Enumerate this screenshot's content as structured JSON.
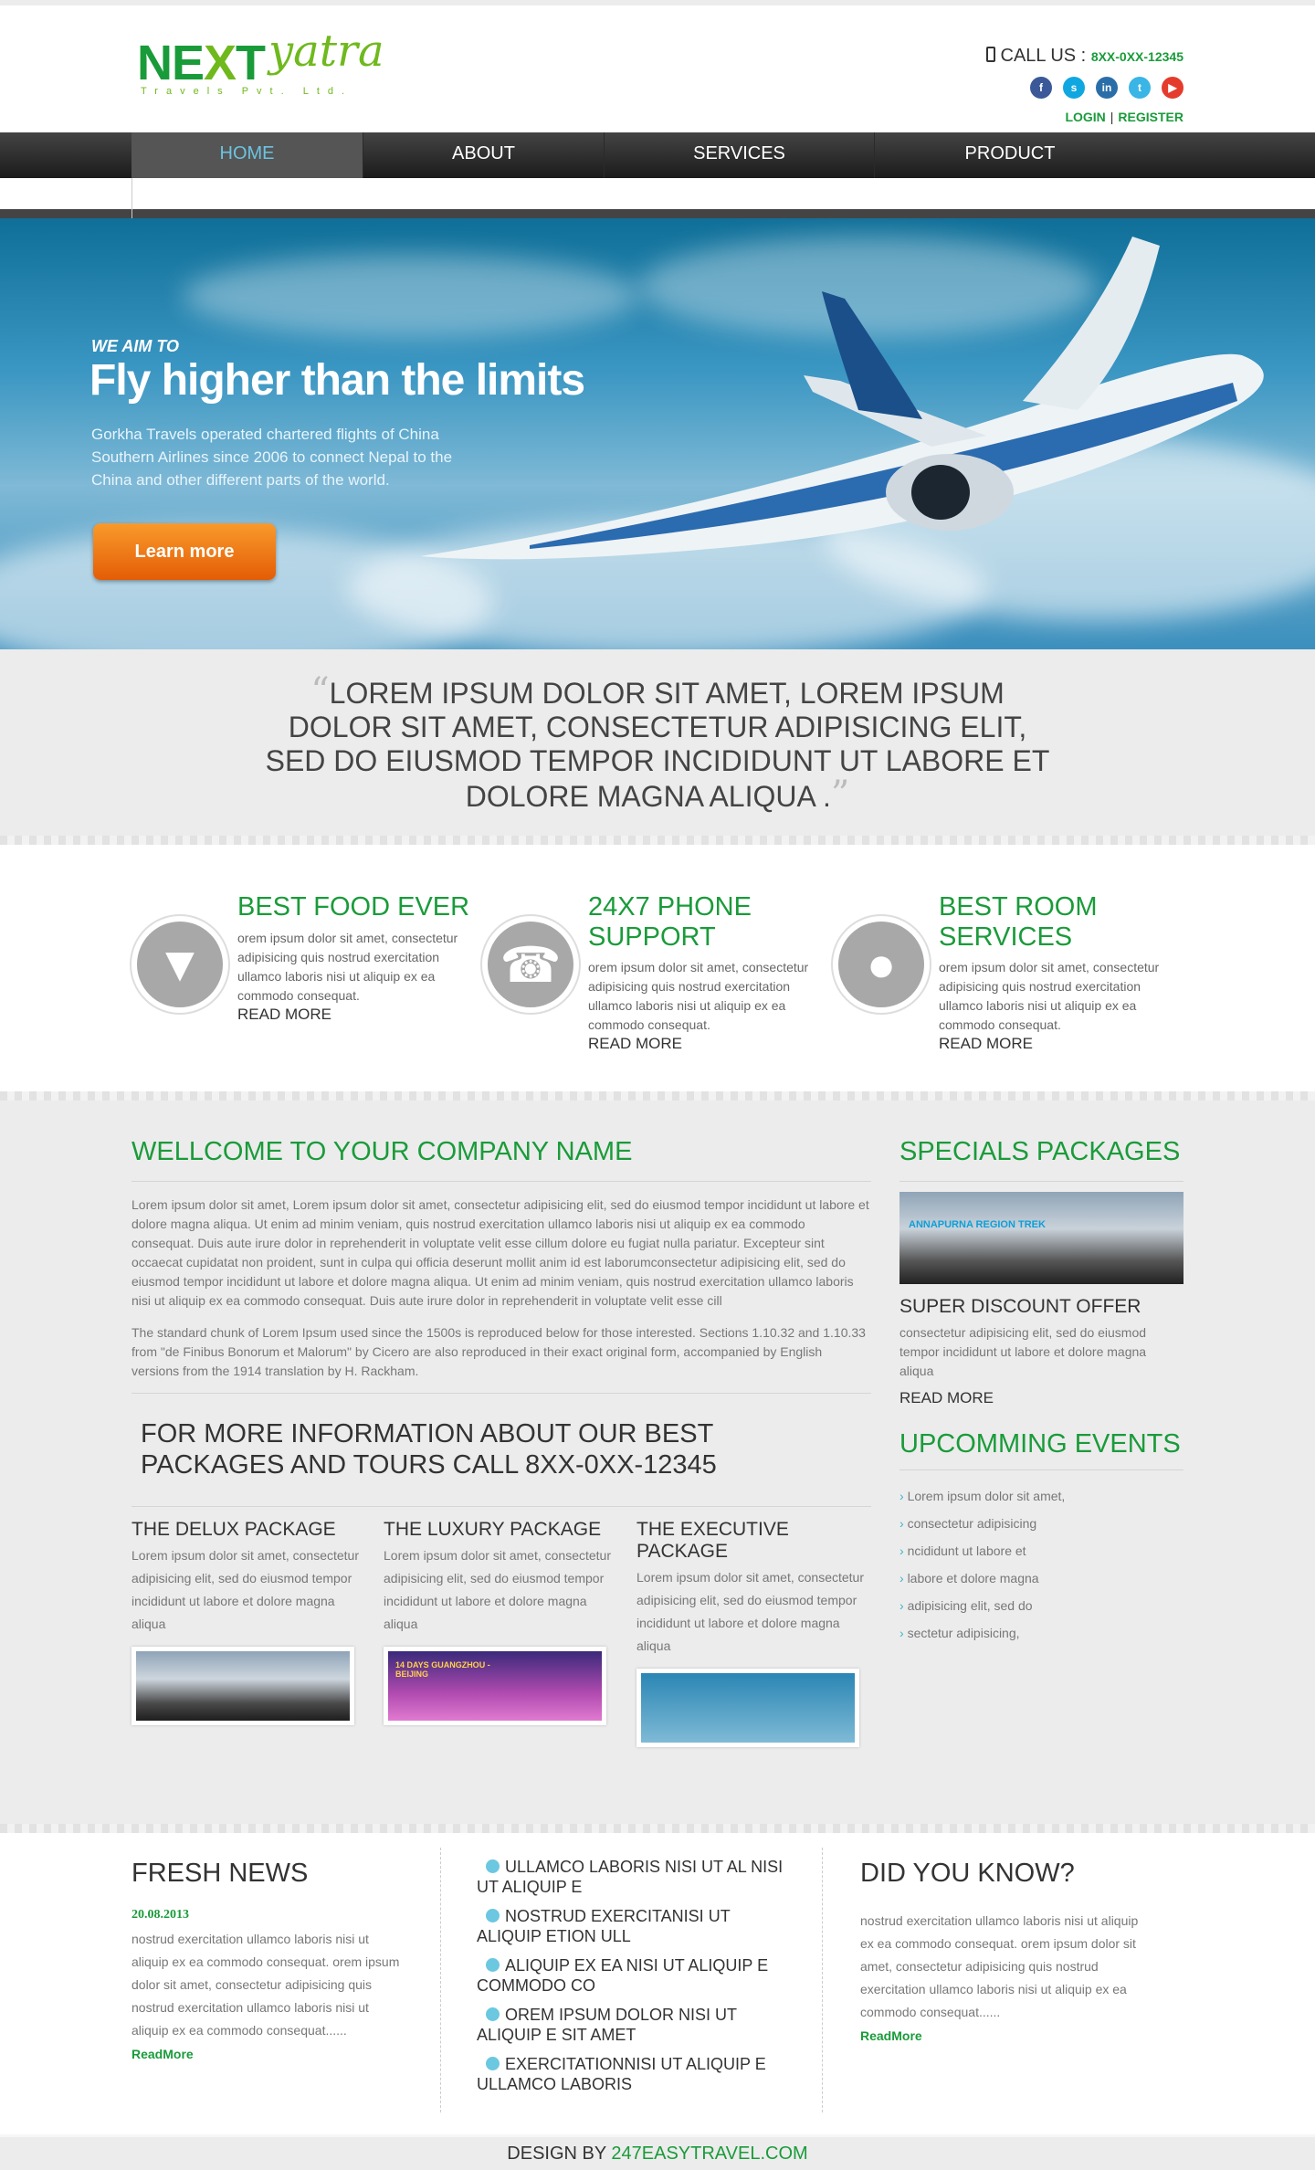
{
  "header": {
    "logo_next": "NEXT",
    "logo_yatra": "yatra",
    "logo_sub": "Travels Pvt. Ltd.",
    "call_label": "CALL US :",
    "call_number": "8XX-0XX-12345",
    "socials": [
      {
        "icon": "facebook-icon",
        "glyph": "f",
        "color": "#3b5998"
      },
      {
        "icon": "skype-icon",
        "glyph": "s",
        "color": "#10a7e0"
      },
      {
        "icon": "linkedin-icon",
        "glyph": "in",
        "color": "#2a6ea9"
      },
      {
        "icon": "twitter-icon",
        "glyph": "t",
        "color": "#39b5e6"
      },
      {
        "icon": "youtube-icon",
        "glyph": "▶",
        "color": "#e53b2c"
      }
    ],
    "login": "LOGIN",
    "register": "REGISTER"
  },
  "nav": {
    "items": [
      "HOME",
      "ABOUT",
      "SERVICES",
      "PRODUCT"
    ],
    "active": "HOME"
  },
  "hero": {
    "aim": "WE AIM TO",
    "title": "Fly higher than the limits",
    "text": "Gorkha Travels operated chartered flights of China Southern Airlines since 2006 to connect Nepal to the China and other different parts of the world.",
    "button": "Learn more"
  },
  "quote": {
    "text": "LOREM IPSUM DOLOR SIT AMET, LOREM IPSUM DOLOR SIT AMET, CONSECTETUR ADIPISICING ELIT, SED DO EIUSMOD TEMPOR INCIDIDUNT UT LABORE ET DOLORE MAGNA ALIQUA ."
  },
  "features": [
    {
      "title": "BEST FOOD EVER",
      "icon": "ice-cream-icon",
      "text": "orem ipsum dolor sit amet, consectetur adipisicing quis nostrud exercitation ullamco laboris nisi ut aliquip ex ea commodo consequat.",
      "more": "READ MORE"
    },
    {
      "title": "24X7 PHONE SUPPORT",
      "icon": "telephone-icon",
      "text": "orem ipsum dolor sit amet, consectetur adipisicing quis nostrud exercitation ullamco laboris nisi ut aliquip ex ea commodo consequat.",
      "more": "READ MORE"
    },
    {
      "title": "BEST ROOM SERVICES",
      "icon": "plate-cutlery-icon",
      "text": "orem ipsum dolor sit amet, consectetur adipisicing quis nostrud exercitation ullamco laboris nisi ut aliquip ex ea commodo consequat.",
      "more": "READ MORE"
    }
  ],
  "welcome": {
    "title": "WELLCOME TO YOUR COMPANY NAME",
    "p1": "Lorem ipsum dolor sit amet, Lorem ipsum dolor sit amet, consectetur adipisicing elit, sed do eiusmod tempor incididunt ut labore et dolore magna aliqua. Ut enim ad minim veniam, quis nostrud exercitation ullamco laboris nisi ut aliquip ex ea commodo consequat. Duis aute irure dolor in reprehenderit in voluptate velit esse cillum dolore eu fugiat nulla pariatur. Excepteur sint occaecat cupidatat non proident, sunt in culpa qui officia deserunt mollit anim id est laborumconsectetur adipisicing elit, sed do eiusmod tempor incididunt ut labore et dolore magna aliqua. Ut enim ad minim veniam, quis nostrud exercitation ullamco laboris nisi ut aliquip ex ea commodo consequat. Duis aute irure dolor in reprehenderit in voluptate velit esse cill",
    "p2": "The standard chunk of Lorem Ipsum used since the 1500s is reproduced below for those interested. Sections 1.10.32 and 1.10.33 from \"de Finibus Bonorum et Malorum\" by Cicero are also reproduced in their exact original form, accompanied by English versions from the 1914 translation by H. Rackham.",
    "callinfo": "FOR MORE INFORMATION ABOUT OUR BEST PACKAGES AND TOURS CALL 8XX-0XX-12345"
  },
  "packages": [
    {
      "title": "THE DELUX PACKAGE",
      "text": "Lorem ipsum dolor sit amet, consectetur adipisicing elit, sed do eiusmod tempor incididunt ut labore et dolore magna aliqua"
    },
    {
      "title": "THE LUXURY PACKAGE",
      "text": "Lorem ipsum dolor sit amet, consectetur adipisicing elit, sed do eiusmod tempor incididunt ut labore et dolore magna aliqua",
      "badge": "14 DAYS GUANGZHOU - BEIJING"
    },
    {
      "title": "THE EXECUTIVE PACKAGE",
      "text": "Lorem ipsum dolor sit amet, consectetur adipisicing elit, sed do eiusmod tempor incididunt ut labore et dolore magna aliqua"
    }
  ],
  "specials": {
    "title": "SPECIALS PACKAGES",
    "img_label": "ANNAPURNA REGION TREK",
    "heading": "SUPER DISCOUNT OFFER",
    "text": "consectetur adipisicing elit, sed do eiusmod tempor incididunt ut labore et dolore magna aliqua",
    "more": "READ MORE"
  },
  "events": {
    "title": "UPCOMMING EVENTS",
    "items": [
      "Lorem ipsum dolor sit amet,",
      "consectetur adipisicing",
      "ncididunt ut labore et",
      "labore et dolore magna",
      "adipisicing elit, sed do",
      "sectetur adipisicing,"
    ]
  },
  "news": {
    "title": "FRESH NEWS",
    "date": "20.08.2013",
    "text": "nostrud exercitation ullamco laboris nisi ut aliquip ex ea commodo consequat. orem ipsum dolor sit amet, consectetur adipisicing quis nostrud exercitation ullamco laboris nisi ut aliquip ex ea commodo consequat......",
    "more": "ReadMore"
  },
  "links": [
    "ULLAMCO LABORIS NISI UT AL NISI UT ALIQUIP E",
    "NOSTRUD EXERCITANISI UT ALIQUIP ETION ULL",
    "ALIQUIP EX EA NISI UT ALIQUIP E COMMODO CO",
    "OREM IPSUM DOLOR NISI UT ALIQUIP E SIT AMET",
    "EXERCITATIONNISI UT ALIQUIP E ULLAMCO LABORIS"
  ],
  "didyouknow": {
    "title": "DID YOU KNOW?",
    "text": "nostrud exercitation ullamco laboris nisi ut aliquip ex ea commodo consequat. orem ipsum dolor sit amet, consectetur adipisicing quis nostrud exercitation ullamco laboris nisi ut aliquip ex ea commodo consequat......",
    "more": "ReadMore"
  },
  "footer": {
    "prefix": "DESIGN BY",
    "link": "247EASYTRAVEL.COM"
  }
}
